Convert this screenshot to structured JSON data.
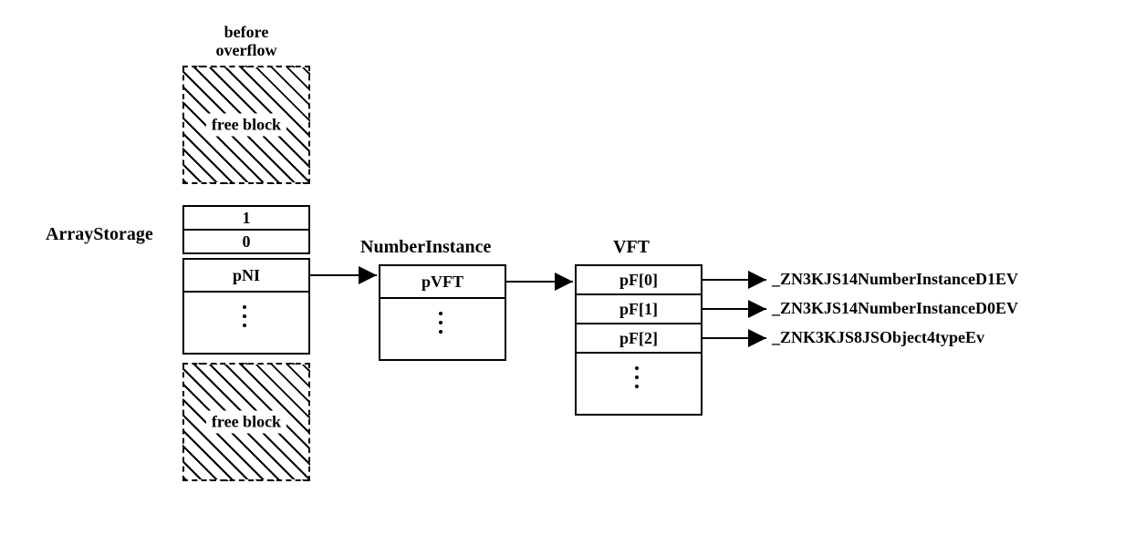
{
  "heading_before": "before\noverflow",
  "free_block_top": "free block",
  "free_block_bottom": "free block",
  "col1_title": "ArrayStorage",
  "col2_title": "NumberInstance",
  "col3_title": "VFT",
  "array_row0": "1",
  "array_row1": "0",
  "array_row2": "pNI",
  "ni_row0": "pVFT",
  "vft_row0": "pF[0]",
  "vft_row1": "pF[1]",
  "vft_row2": "pF[2]",
  "fn0": "_ZN3KJS14NumberInstanceD1EV",
  "fn1": "_ZN3KJS14NumberInstanceD0EV",
  "fn2": "_ZNK3KJS8JSObject4typeEv"
}
